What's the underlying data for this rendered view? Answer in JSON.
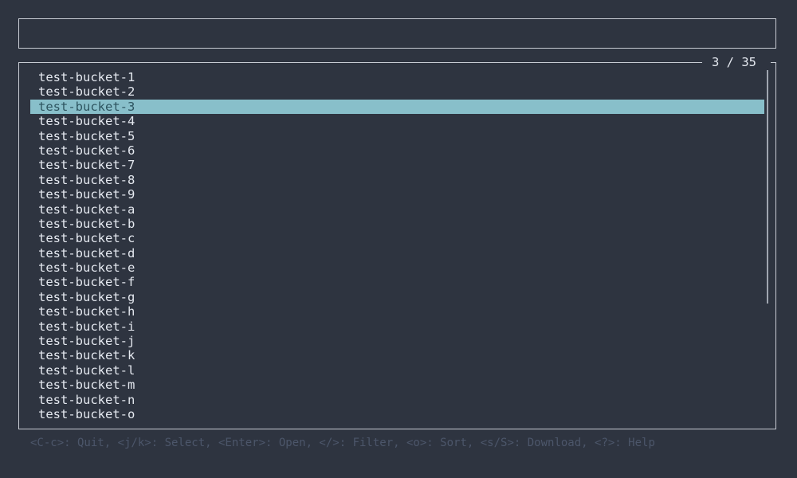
{
  "filter": {
    "value": ""
  },
  "list": {
    "counter": "3 / 35",
    "selected_index": 2,
    "items": [
      "test-bucket-1",
      "test-bucket-2",
      "test-bucket-3",
      "test-bucket-4",
      "test-bucket-5",
      "test-bucket-6",
      "test-bucket-7",
      "test-bucket-8",
      "test-bucket-9",
      "test-bucket-a",
      "test-bucket-b",
      "test-bucket-c",
      "test-bucket-d",
      "test-bucket-e",
      "test-bucket-f",
      "test-bucket-g",
      "test-bucket-h",
      "test-bucket-i",
      "test-bucket-j",
      "test-bucket-k",
      "test-bucket-l",
      "test-bucket-m",
      "test-bucket-n",
      "test-bucket-o"
    ]
  },
  "footer": {
    "help": "<C-c>: Quit, <j/k>: Select, <Enter>: Open, </>: Filter, <o>: Sort, <s/S>: Download, <?>: Help"
  },
  "colors": {
    "background": "#2e3440",
    "selection": "#88bfca",
    "text": "#e5e9f0",
    "dim": "#4c566a"
  }
}
